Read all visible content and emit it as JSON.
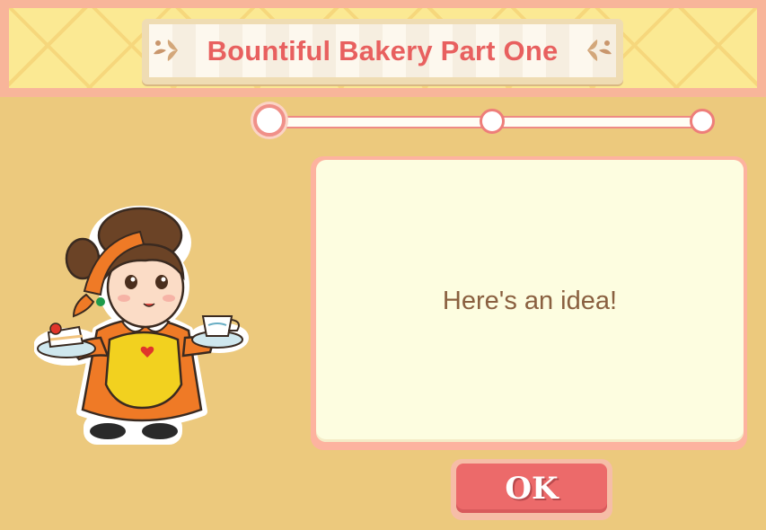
{
  "header": {
    "title": "Bountiful Bakery Part One"
  },
  "progress": {
    "total_steps": 3,
    "current_step": 1
  },
  "dialog": {
    "message": "Here's an idea!"
  },
  "ok_button": {
    "label": "OK"
  },
  "character": {
    "icon": "baker-lady-character"
  },
  "colors": {
    "background": "#ecc97d",
    "title": "#e8605f",
    "button": "#ec6a6a",
    "dialog": "#fdfde0"
  }
}
